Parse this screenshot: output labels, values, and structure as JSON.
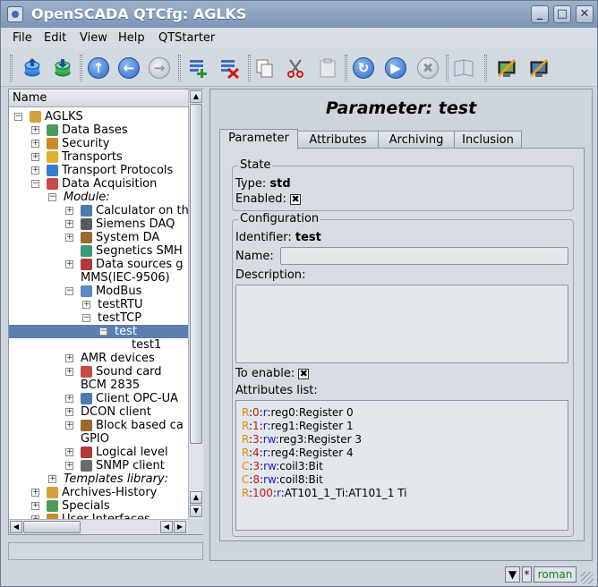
{
  "window": {
    "title": "OpenSCADA QTCfg: AGLKS"
  },
  "menu": [
    "File",
    "Edit",
    "View",
    "Help",
    "QTStarter"
  ],
  "toolbar": {
    "buttons": [
      "db-load-icon",
      "db-save-icon",
      "up-icon",
      "back-icon",
      "forward-icon",
      "add-item-icon",
      "delete-item-icon",
      "copy-icon",
      "cut-icon",
      "paste-icon",
      "refresh-icon",
      "start-icon",
      "stop-icon",
      "manual-icon",
      "station-icon",
      "station-config-icon"
    ]
  },
  "tree": {
    "header": "Name",
    "rows": [
      {
        "label": "AGLKS",
        "level": 0,
        "exp": "-",
        "icon": "station-icon"
      },
      {
        "label": "Data Bases",
        "level": 1,
        "exp": "+",
        "icon": "database-icon"
      },
      {
        "label": "Security",
        "level": 1,
        "exp": "+",
        "icon": "security-icon"
      },
      {
        "label": "Transports",
        "level": 1,
        "exp": "+",
        "icon": "transports-icon"
      },
      {
        "label": "Transport Protocols",
        "level": 1,
        "exp": "+",
        "icon": "protocols-icon"
      },
      {
        "label": "Data Acquisition",
        "level": 1,
        "exp": "-",
        "icon": "daq-icon"
      },
      {
        "label": "Module:",
        "level": 2,
        "exp": "-",
        "italic": true
      },
      {
        "label": "Calculator on th",
        "level": 3,
        "exp": "+",
        "icon": "calculator-icon"
      },
      {
        "label": "Siemens DAQ",
        "level": 3,
        "exp": "+",
        "icon": "siemens-icon"
      },
      {
        "label": "System DA",
        "level": 3,
        "exp": "+",
        "icon": "system-icon"
      },
      {
        "label": "Segnetics SMH",
        "level": 3,
        "exp": "",
        "icon": "segnetics-icon"
      },
      {
        "label": "Data sources g",
        "level": 3,
        "exp": "+",
        "icon": "datasources-icon"
      },
      {
        "label": "MMS(IEC-9506)",
        "level": 3,
        "exp": ""
      },
      {
        "label": "ModBus",
        "level": 3,
        "exp": "-",
        "icon": "modbus-icon"
      },
      {
        "label": "testRTU",
        "level": 4,
        "exp": "+"
      },
      {
        "label": "testTCP",
        "level": 4,
        "exp": "-"
      },
      {
        "label": "test",
        "level": 5,
        "exp": "-",
        "selected": true
      },
      {
        "label": "test1",
        "level": 6,
        "exp": ""
      },
      {
        "label": "AMR devices",
        "level": 3,
        "exp": "+"
      },
      {
        "label": "Sound card",
        "level": 3,
        "exp": "+",
        "icon": "sound-icon"
      },
      {
        "label": "BCM 2835",
        "level": 3,
        "exp": ""
      },
      {
        "label": "Client OPC-UA",
        "level": 3,
        "exp": "+",
        "icon": "opcua-icon"
      },
      {
        "label": "DCON client",
        "level": 3,
        "exp": "+"
      },
      {
        "label": "Block based ca",
        "level": 3,
        "exp": "+",
        "icon": "block-icon"
      },
      {
        "label": "GPIO",
        "level": 3,
        "exp": ""
      },
      {
        "label": "Logical level",
        "level": 3,
        "exp": "+",
        "icon": "logical-icon"
      },
      {
        "label": "SNMP client",
        "level": 3,
        "exp": "+",
        "icon": "snmp-icon"
      },
      {
        "label": "Templates library:",
        "level": 2,
        "exp": "+",
        "italic": true
      },
      {
        "label": "Archives-History",
        "level": 1,
        "exp": "+",
        "icon": "archives-icon"
      },
      {
        "label": "Specials",
        "level": 1,
        "exp": "+",
        "icon": "specials-icon"
      },
      {
        "label": "User Interfaces",
        "level": 1,
        "exp": "+",
        "icon": "ui-icon"
      }
    ]
  },
  "page": {
    "title": "Parameter: test",
    "tabs": [
      "Parameter",
      "Attributes",
      "Archiving",
      "Inclusion"
    ],
    "state": {
      "legend": "State",
      "type_label": "Type:",
      "type_value": "std",
      "enabled_label": "Enabled:",
      "enabled_mark": "✖"
    },
    "config": {
      "legend": "Configuration",
      "identifier_label": "Identifier:",
      "identifier_value": "test",
      "name_label": "Name:",
      "name_value": "",
      "description_label": "Description:",
      "description_value": "",
      "to_enable_label": "To enable:",
      "to_enable_mark": "✖",
      "attr_list_label": "Attributes list:",
      "attributes": [
        {
          "t": "R",
          "addr": "0",
          "mode": "r",
          "rest": "reg0:Register 0"
        },
        {
          "t": "R",
          "addr": "1",
          "mode": "r",
          "rest": "reg1:Register 1"
        },
        {
          "t": "R",
          "addr": "3",
          "mode": "rw",
          "rest": "reg3:Register 3"
        },
        {
          "t": "R",
          "addr": "4",
          "mode": "r",
          "rest": "reg4:Register 4"
        },
        {
          "t": "C",
          "addr": "3",
          "mode": "rw",
          "rest": "coil3:Bit"
        },
        {
          "t": "C",
          "addr": "8",
          "mode": "rw",
          "rest": "coil8:Bit"
        },
        {
          "t": "R",
          "addr": "100",
          "mode": "r",
          "rest": "AT101_1_Ti:AT101_1 Ti"
        }
      ]
    }
  },
  "status": {
    "user": "roman",
    "star": "*"
  }
}
